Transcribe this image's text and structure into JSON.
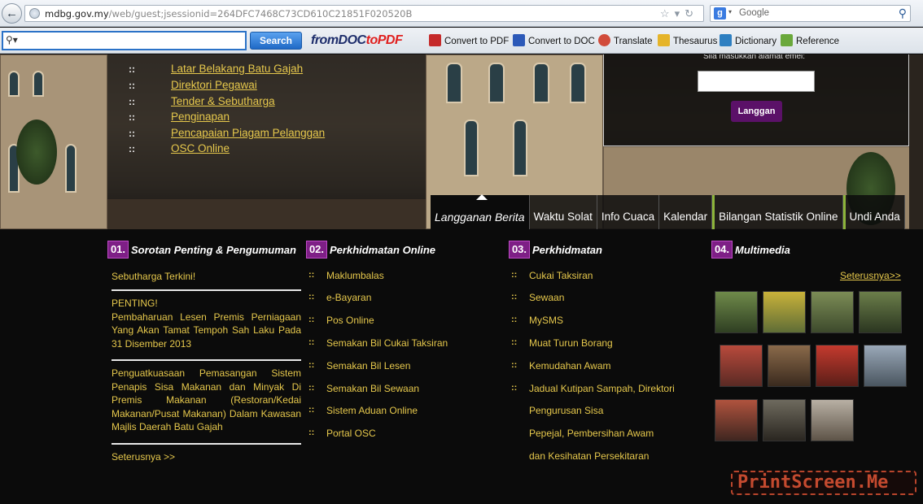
{
  "browser": {
    "url_host": "mdbg.gov.my",
    "url_path": "/web/guest;jsessionid=264DFC7468C73CD610C21851F020520B",
    "search_engine_placeholder": "Google",
    "toolbar_search_label": "Search",
    "toolbar_logo_a": "fromDOC",
    "toolbar_logo_b": "toPDF",
    "toolbar_items": [
      "Convert to PDF",
      "Convert to DOC",
      "Translate",
      "Thesaurus",
      "Dictionary",
      "Reference"
    ]
  },
  "quick_links": [
    "Latar Belakang Batu Gajah",
    "Direktori Pegawai",
    "Tender & Sebutharga",
    "Penginapan",
    "Pencapaian Piagam Pelanggan",
    "OSC Online"
  ],
  "newsletter": {
    "prompt": "Sila masukkan alamat emel:",
    "button": "Langgan"
  },
  "tabs": [
    "Langganan Berita",
    "Waktu Solat",
    "Info Cuaca",
    "Kalendar",
    "Bilangan Statistik Online",
    "Undi Anda"
  ],
  "sections": [
    {
      "num": "01.",
      "title": "Sorotan Penting & Pengumuman"
    },
    {
      "num": "02.",
      "title": "Perkhidmatan Online"
    },
    {
      "num": "03.",
      "title": "Perkhidmatan"
    },
    {
      "num": "04.",
      "title": "Multimedia"
    }
  ],
  "announcements": {
    "item1": "Sebutharga Terkini!",
    "item2_head": "PENTING!",
    "item2_body": "Pembaharuan Lesen Premis Perniagaan Yang Akan Tamat Tempoh Sah Laku Pada 31 Disember 2013",
    "item3": "Penguatkuasaan Pemasangan Sistem Penapis Sisa Makanan dan Minyak Di Premis Makanan (Restoran/Kedai Makanan/Pusat Makanan) Dalam Kawasan Majlis Daerah Batu Gajah",
    "more": "Seterusnya >>"
  },
  "online_services": [
    "Maklumbalas",
    "e-Bayaran",
    "Pos Online",
    "Semakan Bil Cukai Taksiran",
    "Semakan Bil Lesen",
    "Semakan Bil Sewaan",
    "Sistem Aduan Online",
    "Portal OSC"
  ],
  "services": [
    "Cukai Taksiran",
    "Sewaan",
    "MySMS",
    "Muat Turun Borang",
    "Kemudahan Awam",
    "Jadual Kutipan Sampah, Direktori",
    "Pengurusan Sisa",
    "Pepejal, Pembersihan Awam",
    "dan Kesihatan Persekitaran"
  ],
  "bullet": "::",
  "multimedia_more": "Seterusnya>>",
  "watermark": "PrintScreen.Me"
}
